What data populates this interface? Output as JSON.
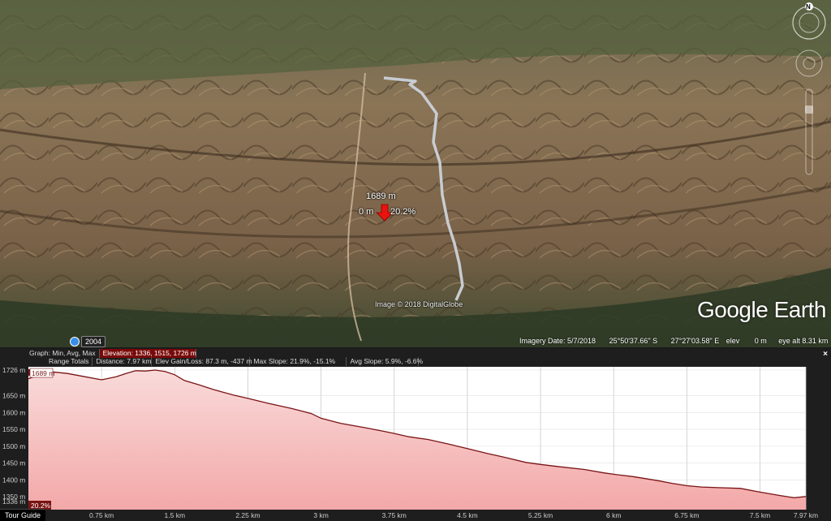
{
  "map": {
    "marker": {
      "elevation": "1689 m",
      "distance": "0 m",
      "slope": "20.2%"
    },
    "imagery_credit": "Image © 2018 DigitalGlobe",
    "logo": "Google Earth",
    "year": "2004",
    "status": {
      "imagery_date": "Imagery Date: 5/7/2018",
      "lat": "25°50'37.66\" S",
      "lon": "27°27'03.58\" E",
      "elev_label": "elev",
      "elev_value": "0 m",
      "eye_alt": "eye alt   8.31 km"
    },
    "compass": "N",
    "colors": {
      "path": "#c8ccd2",
      "marker": "#e8140e"
    }
  },
  "elevation_panel": {
    "graph_label": "Graph: Min, Avg, Max",
    "elevation": "Elevation: 1336, 1515, 1726 m",
    "range_label": "Range Totals",
    "distance": "Distance: 7.97 km",
    "gain_loss": "Elev Gain/Loss: 87.3 m, -437 m",
    "max_slope": "Max Slope: 21.9%, -15.1%",
    "avg_slope": "Avg Slope: 5.9%, -6.6%",
    "close": "×",
    "cursor_elev": "1689 m",
    "cursor_slope": "20.2%",
    "tour_guide": "Tour Guide"
  },
  "chart_data": {
    "type": "area",
    "xlabel": "",
    "ylabel": "",
    "ylim": [
      1336,
      1726
    ],
    "xlim": [
      0,
      7.97
    ],
    "y_ticks": [
      "1726 m",
      "1650 m",
      "1600 m",
      "1550 m",
      "1500 m",
      "1450 m",
      "1400 m",
      "1350 m",
      "1336 m"
    ],
    "y_tick_values": [
      1726,
      1650,
      1600,
      1550,
      1500,
      1450,
      1400,
      1350,
      1336
    ],
    "x_ticks": [
      "0.75 km",
      "1.5 km",
      "2.25 km",
      "3 km",
      "3.75 km",
      "4.5 km",
      "5.25 km",
      "6 km",
      "6.75 km",
      "7.5 km",
      "7.97 km"
    ],
    "x_tick_values": [
      0.75,
      1.5,
      2.25,
      3,
      3.75,
      4.5,
      5.25,
      6,
      6.75,
      7.5,
      7.97
    ],
    "series": [
      {
        "x": [
          0,
          0.2,
          0.4,
          0.6,
          0.75,
          0.9,
          1.0,
          1.1,
          1.2,
          1.3,
          1.4,
          1.5,
          1.6,
          1.75,
          1.9,
          2.1,
          2.25,
          2.45,
          2.7,
          2.9,
          3.0,
          3.2,
          3.45,
          3.65,
          3.75,
          3.9,
          4.1,
          4.3,
          4.5,
          4.7,
          4.9,
          5.1,
          5.25,
          5.45,
          5.7,
          5.9,
          6.0,
          6.2,
          6.45,
          6.6,
          6.75,
          6.9,
          7.1,
          7.3,
          7.5,
          7.7,
          7.85,
          7.97
        ],
        "y": [
          1700,
          1722,
          1716,
          1705,
          1697,
          1706,
          1716,
          1724,
          1723,
          1726,
          1722,
          1712,
          1695,
          1682,
          1668,
          1652,
          1642,
          1628,
          1612,
          1597,
          1583,
          1568,
          1555,
          1544,
          1538,
          1528,
          1520,
          1507,
          1493,
          1479,
          1466,
          1452,
          1446,
          1439,
          1431,
          1421,
          1417,
          1410,
          1398,
          1390,
          1383,
          1379,
          1377,
          1375,
          1364,
          1354,
          1347,
          1351
        ]
      }
    ],
    "grid": true,
    "colors": {
      "line": "#7a1414",
      "fill_top": "#f8d6d6",
      "fill_bottom": "#f0a0a0",
      "bg": "#ffffff"
    }
  }
}
